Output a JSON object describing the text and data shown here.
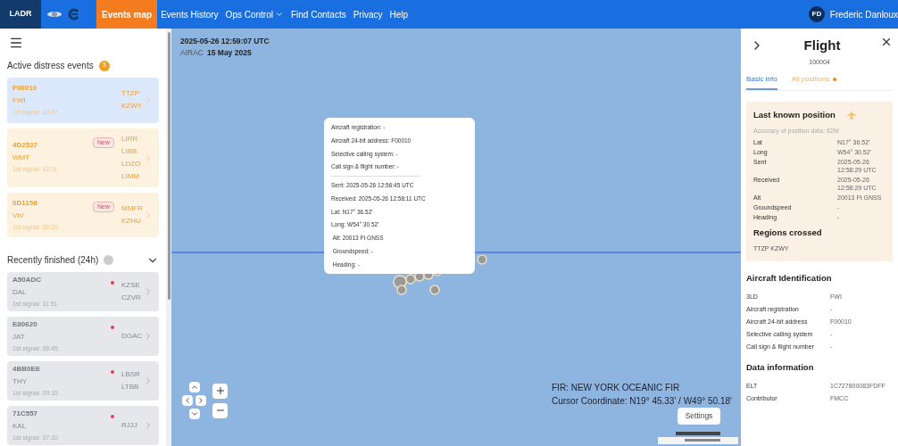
{
  "nav": {
    "brand": "LADR",
    "items": [
      {
        "label": "Events map",
        "selected": true,
        "dropdown": false
      },
      {
        "label": "Events History",
        "selected": false,
        "dropdown": false
      },
      {
        "label": "Ops Control",
        "selected": false,
        "dropdown": true
      },
      {
        "label": "Find Contacts",
        "selected": false,
        "dropdown": false
      },
      {
        "label": "Privacy",
        "selected": false,
        "dropdown": false
      },
      {
        "label": "Help",
        "selected": false,
        "dropdown": false
      }
    ],
    "user": {
      "initials": "FD",
      "name": "Frederic Danloux"
    }
  },
  "sidebar": {
    "active": {
      "title": "Active distress events",
      "count": "3",
      "events": [
        {
          "id": "F00010",
          "operator": "FWI",
          "signal": "1st signal: 12:47",
          "regions": [
            "TTZP",
            "KZWY"
          ],
          "selected": true
        },
        {
          "id": "4D2527",
          "operator": "WMT",
          "signal": "1st signal: 12:11",
          "regions": [
            "LIRR",
            "LIBB",
            "LDZO",
            "LIMM"
          ],
          "badge": "New",
          "selected": false
        },
        {
          "id": "0D1158",
          "operator": "VIV",
          "signal": "1st signal: 06:20",
          "regions": [
            "MMFR",
            "KZHU"
          ],
          "badge": "New",
          "selected": false
        }
      ]
    },
    "finished": {
      "title": "Recently finished (24h)",
      "expanded": true,
      "events": [
        {
          "id": "A50ADC",
          "operator": "DAL",
          "signal": "1st signal: 11:51",
          "regions": [
            "KZSE",
            "CZVR"
          ],
          "alert": true
        },
        {
          "id": "E80620",
          "operator": "JAT",
          "signal": "1st signal: 06:45",
          "regions": [
            "DGAC"
          ],
          "alert": true
        },
        {
          "id": "4BB0EE",
          "operator": "THY",
          "signal": "1st signal: 09:15",
          "regions": [
            "LBSR",
            "LTBB"
          ],
          "alert": true
        },
        {
          "id": "71C557",
          "operator": "KAL",
          "signal": "1st signal: 07:10",
          "regions": [
            "RJJJ"
          ],
          "alert": true
        }
      ]
    }
  },
  "map": {
    "timestamp": "2025-05-26 12:59:07 UTC",
    "airac_label": "AIRAC",
    "airac_value": "15 May 2025",
    "popup": {
      "identity": [
        "Aircraft registration: -",
        "Aircraft 24-bit address: F00010",
        "Selective calling system: -",
        "Call sign & flight number: -"
      ],
      "position": [
        "Sent: 2025-05-26 12:56:45 UTC",
        "Received: 2025-05-26 12:58:11 UTC",
        "Lat: N17° 36.52'",
        "Long: W54° 30.52'",
        " Alt: 20013 Ft GNSS",
        " Groundspeed: -",
        " Heading: -"
      ]
    },
    "fir": "FIR: NEW YORK OCEANIC FIR",
    "cursor": "Cursor Coordinate: N19° 45.33' / W49° 50.18'",
    "settings": "Settings"
  },
  "panel": {
    "title": "Flight",
    "subtitle": "100004",
    "tabs": [
      {
        "label": "Basic info",
        "selected": true,
        "dot": false
      },
      {
        "label": "All positions",
        "selected": false,
        "dot": true
      }
    ],
    "last_known": {
      "title": "Last known position",
      "accuracy": "Accuracy of position data: 62M",
      "rows": [
        {
          "label": "Lat",
          "value": "N17° 36.52'"
        },
        {
          "label": "Long",
          "value": "W54° 30.52'"
        },
        {
          "label": "Sent",
          "value": "2025-05-26 12:58:29 UTC"
        },
        {
          "label": "Received",
          "value": "2025-05-26 12:58:29 UTC"
        },
        {
          "label": "Alt",
          "value": "20013 Ft GNSS"
        },
        {
          "label": "Groundspeed",
          "value": "-"
        },
        {
          "label": "Heading",
          "value": "-"
        }
      ],
      "regions_title": "Regions crossed",
      "regions": "TTZP KZWY"
    },
    "sections": [
      {
        "title": "Aircraft Identification",
        "rows": [
          {
            "label": "3LD",
            "value": "FWI"
          },
          {
            "label": "Aircraft registration",
            "value": "-"
          },
          {
            "label": "Aircraft 24-bit address",
            "value": "F00010"
          },
          {
            "label": "Selective calling system",
            "value": "-"
          },
          {
            "label": "Call sign & flight number",
            "value": "-"
          }
        ]
      },
      {
        "title": "Data information",
        "rows": [
          {
            "label": "ELT",
            "value": "1C727800083FDFF"
          },
          {
            "label": "Contributor",
            "value": "FMCC"
          }
        ]
      }
    ]
  }
}
